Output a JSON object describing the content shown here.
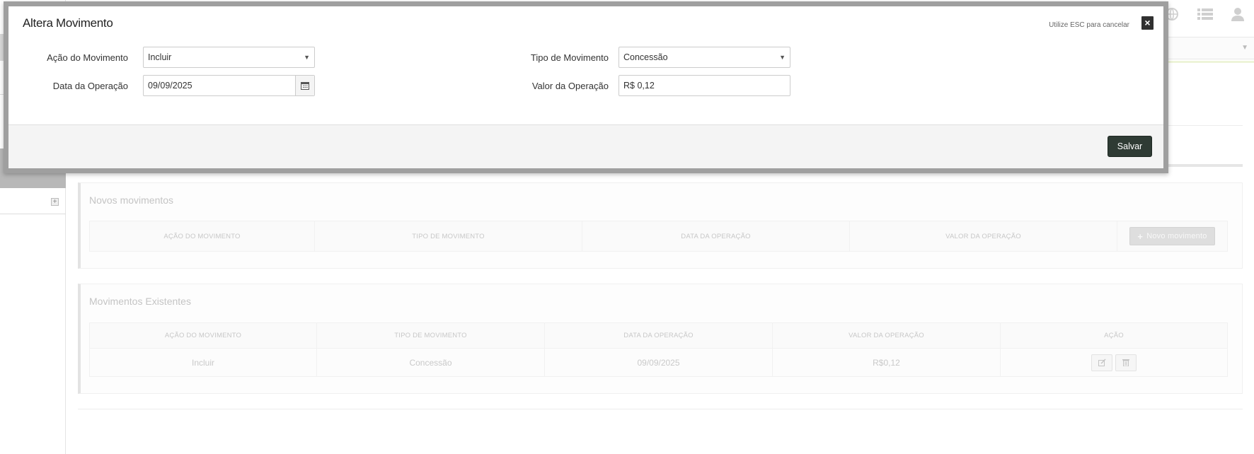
{
  "modal": {
    "title": "Altera Movimento",
    "esc_hint": "Utilize ESC para cancelar",
    "close_label": "×",
    "fields": {
      "acao_label": "Ação do Movimento",
      "acao_value": "Incluir",
      "tipo_label": "Tipo de Movimento",
      "tipo_value": "Concessão",
      "data_label": "Data da Operação",
      "data_value": "09/09/2025",
      "valor_label": "Valor da Operação",
      "valor_value": "R$ 0,12"
    },
    "save_label": "Salvar"
  },
  "novos": {
    "title": "Novos movimentos",
    "columns": [
      "AÇÃO DO MOVIMENTO",
      "TIPO DE MOVIMENTO",
      "DATA DA OPERAÇÃO",
      "VALOR DA OPERAÇÃO"
    ],
    "new_button_icon": "+",
    "new_button_label": "Novo movimento"
  },
  "existentes": {
    "title": "Movimentos Existentes",
    "columns": [
      "AÇÃO DO MOVIMENTO",
      "TIPO DE MOVIMENTO",
      "DATA DA OPERAÇÃO",
      "VALOR DA OPERAÇÃO",
      "AÇÃO"
    ],
    "rows": [
      {
        "acao": "Incluir",
        "tipo": "Concessão",
        "data": "09/09/2025",
        "valor": "R$0,12"
      }
    ]
  },
  "icons": {
    "top_bar": [
      "globe-icon",
      "list-icon",
      "user-icon"
    ],
    "row_actions": [
      "edit-icon",
      "trash-icon"
    ],
    "date": "calendar-icon",
    "sidebar": "expand-icon"
  },
  "colors": {
    "modal_border": "#9f9f9f",
    "save_button": "#2f3b34",
    "close_button": "#303030",
    "footer_bg": "#f4f4f4"
  }
}
